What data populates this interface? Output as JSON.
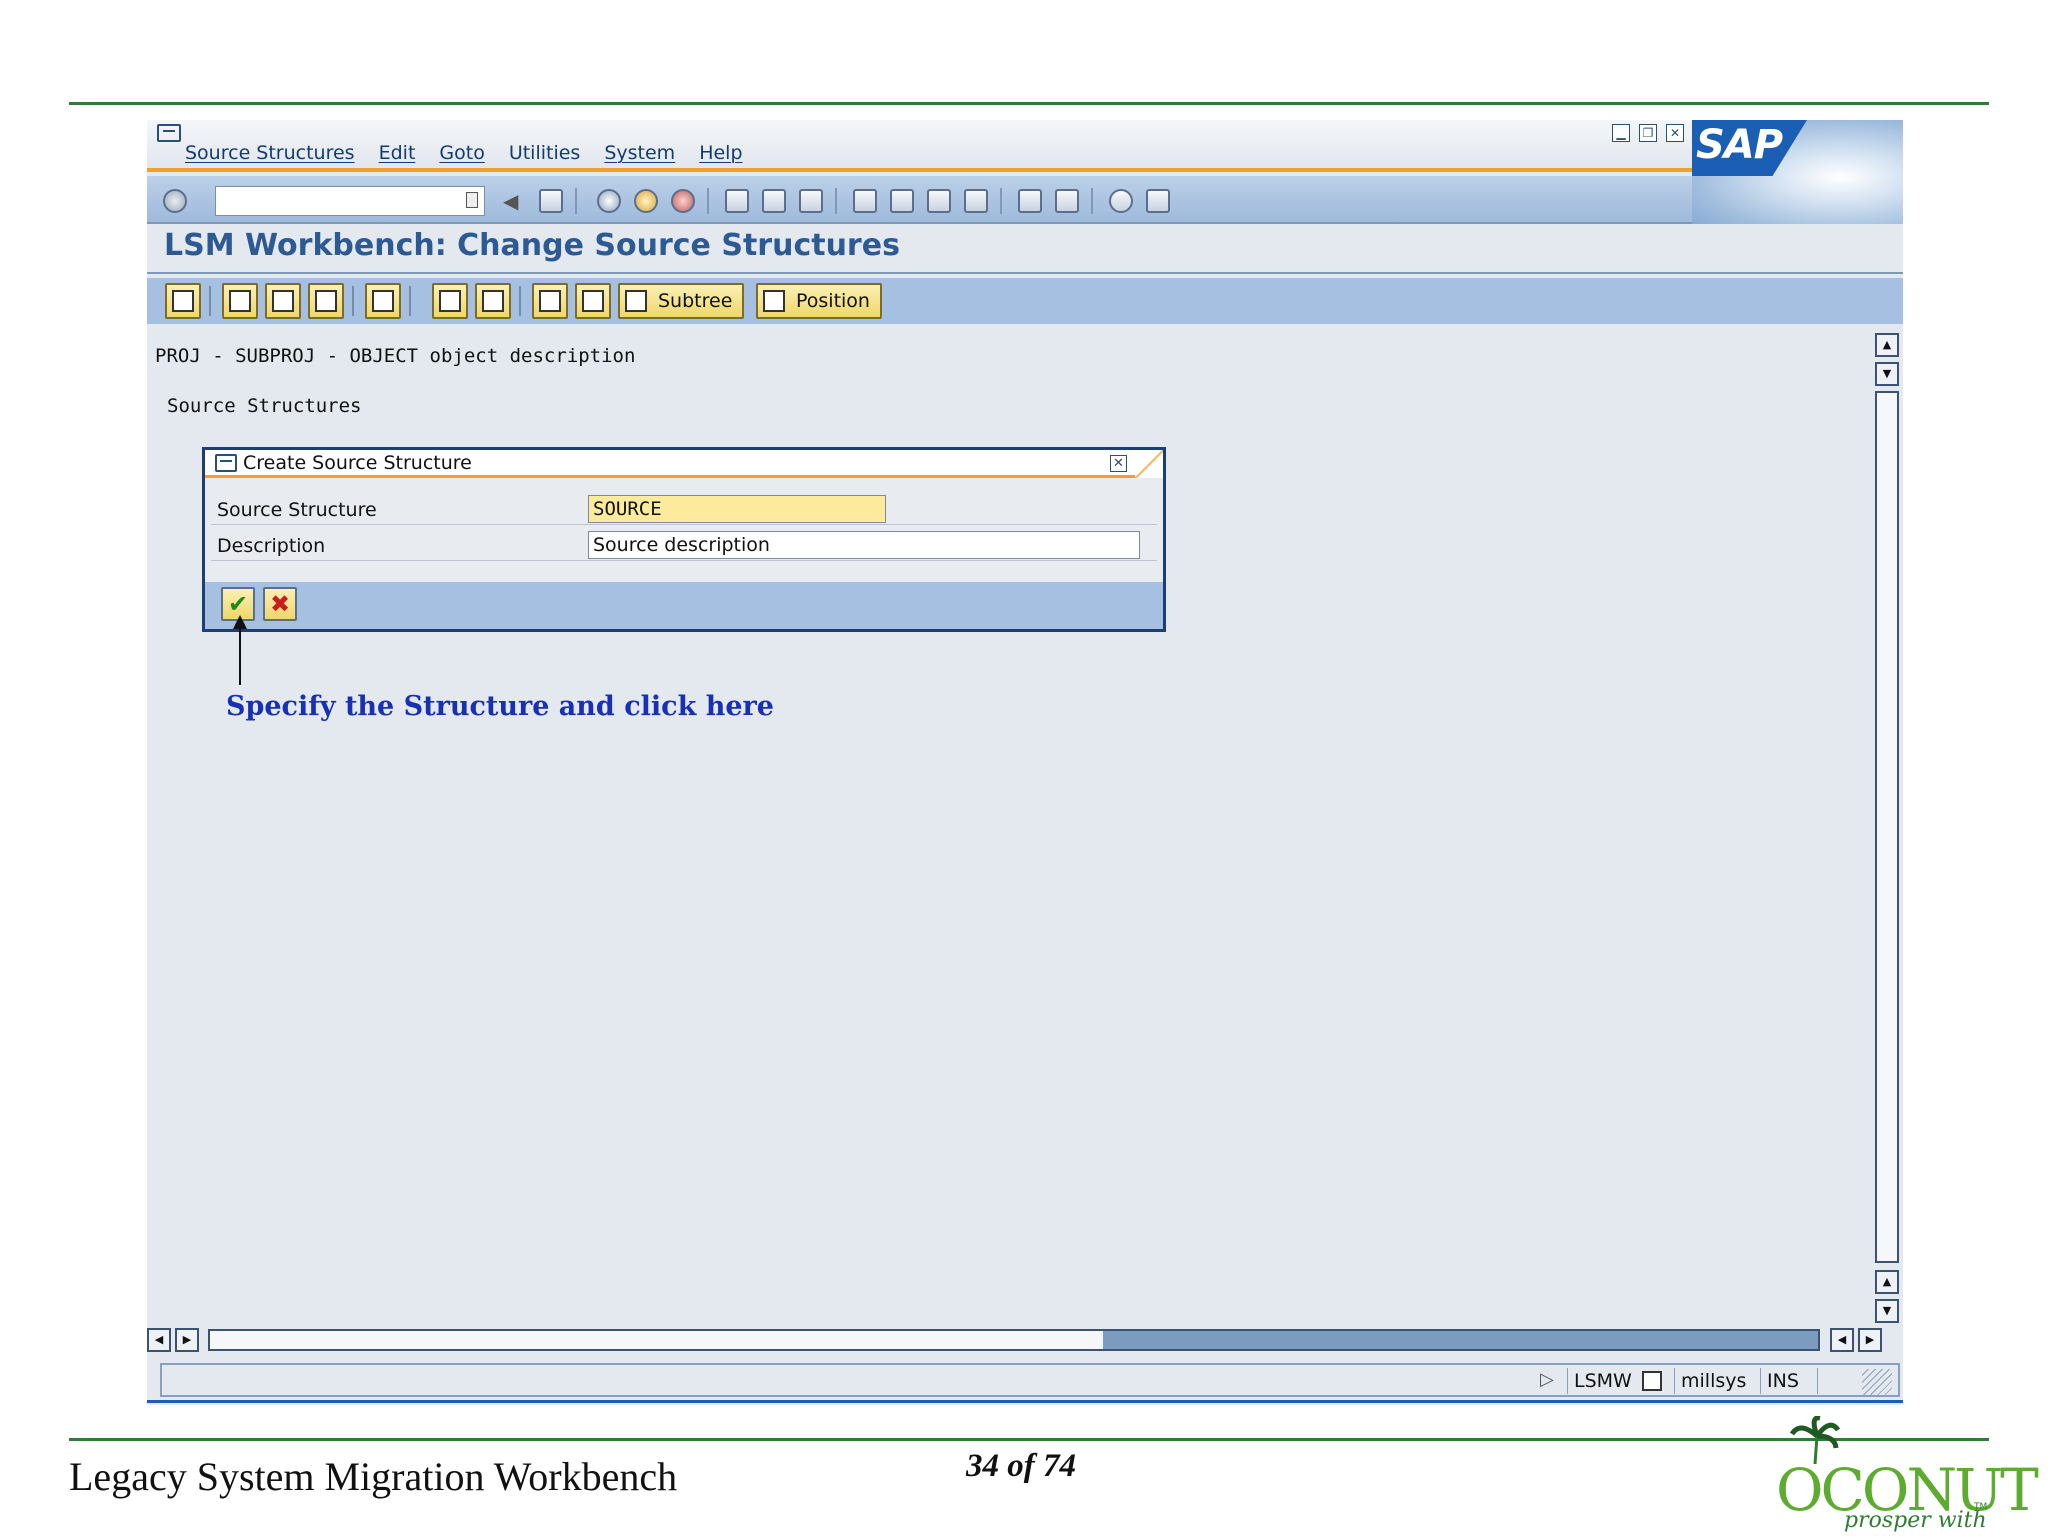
{
  "menubar": {
    "items": [
      "Source Structures",
      "Edit",
      "Goto",
      "Utilities",
      "System",
      "Help"
    ]
  },
  "window": {
    "title": "LSM Workbench: Change Source Structures",
    "logo_text": "SAP"
  },
  "app_toolbar": {
    "subtree_label": "Subtree",
    "position_label": "Position"
  },
  "content": {
    "project_line": "PROJ - SUBPROJ - OBJECT object description",
    "section_label": "Source Structures"
  },
  "dialog": {
    "title": "Create Source Structure",
    "fields": [
      {
        "label": "Source Structure",
        "value": "SOURCE"
      },
      {
        "label": "Description",
        "value": "Source description"
      }
    ]
  },
  "annotation": {
    "text": "Specify the Structure and click here"
  },
  "status_bar": {
    "transaction": "LSMW",
    "system": "millsys",
    "mode": "INS"
  },
  "footer": {
    "title": "Legacy System Migration Workbench",
    "page": "34 of 74",
    "logo_word": "OCONUT",
    "logo_tagline": "prosper with us",
    "logo_tm": "TM"
  },
  "colors": {
    "accent_orange": "#f0a030",
    "toolbar_blue": "#a6c0e2",
    "rule_green": "#2f7d32",
    "annotation_blue": "#1830b4"
  },
  "scroll": {
    "horizontal_thumb_fraction": 0.44
  }
}
